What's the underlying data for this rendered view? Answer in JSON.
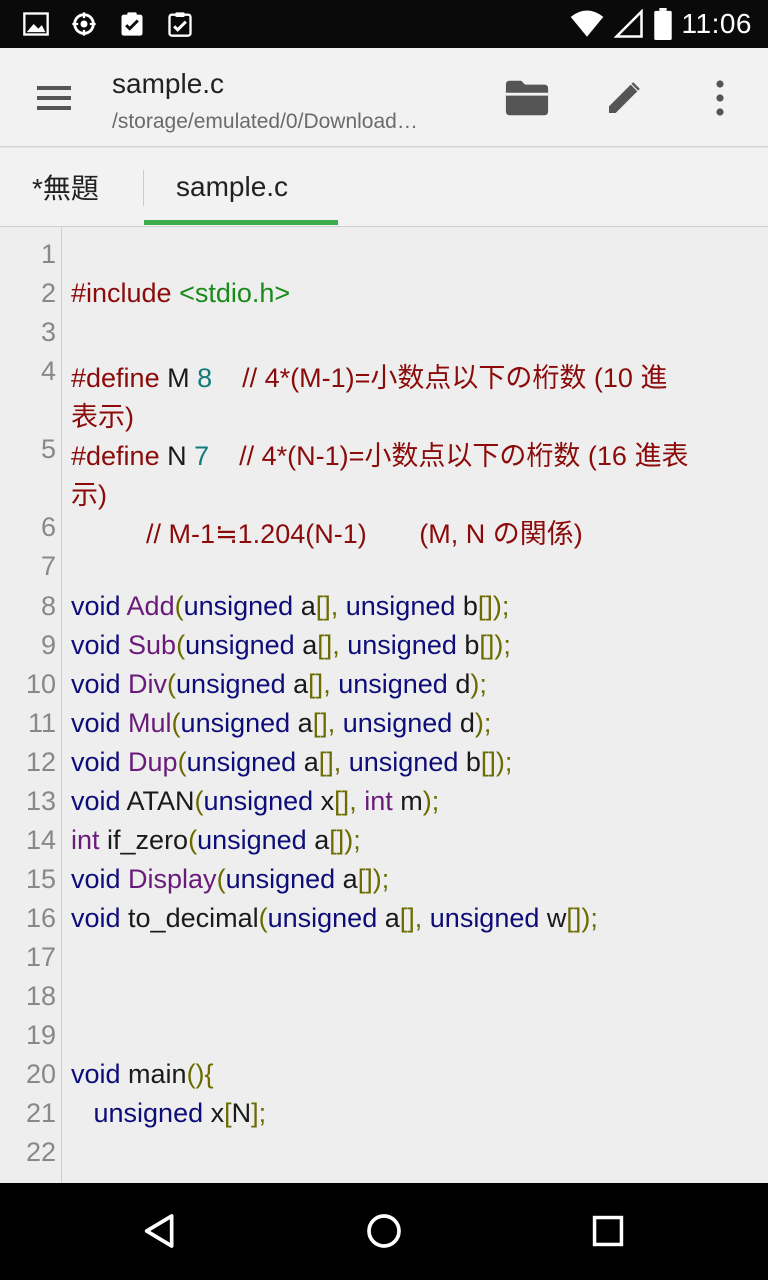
{
  "status_bar": {
    "time": "11:06",
    "left_icons": [
      "image-icon",
      "sync-icon",
      "clipboard-check-icon",
      "clipboard-check-2-icon"
    ],
    "right_icons": [
      "wifi-icon",
      "signal-icon",
      "battery-icon"
    ]
  },
  "app_bar": {
    "title": "sample.c",
    "subtitle": "/storage/emulated/0/Download…"
  },
  "tabs": [
    {
      "label": "*無題",
      "active": false
    },
    {
      "label": "sample.c",
      "active": true
    }
  ],
  "editor": {
    "line_numbers": [
      "1",
      "2",
      "3",
      "4",
      "",
      "5",
      "",
      "6",
      "7",
      "8",
      "9",
      "10",
      "11",
      "12",
      "13",
      "14",
      "15",
      "16",
      "17",
      "18",
      "19",
      "20",
      "21",
      "22"
    ],
    "lines": {
      "l2_a": "#include ",
      "l2_b": "<stdio.h>",
      "l4_a": "#define ",
      "l4_b": "M ",
      "l4_c": "8",
      "l4_d": "    // 4*(M-1)=小数点以下の桁数 (10 進",
      "l4w": "表示)",
      "l5_a": "#define ",
      "l5_b": "N ",
      "l5_c": "7",
      "l5_d": "    // 4*(N-1)=小数点以下の桁数 (16 進表",
      "l5w": "示)",
      "l6": "          // M-1≒1.204(N-1)       (M, N の関係)",
      "l8": [
        "void",
        " Add",
        "(",
        "unsigned",
        " a",
        "[]",
        ", ",
        "unsigned",
        " b",
        "[]",
        ");"
      ],
      "l9": [
        "void",
        " Sub",
        "(",
        "unsigned",
        " a",
        "[]",
        ", ",
        "unsigned",
        " b",
        "[]",
        ");"
      ],
      "l10": [
        "void",
        " Div",
        "(",
        "unsigned",
        " a",
        "[]",
        ", ",
        "unsigned",
        " d",
        ");"
      ],
      "l11": [
        "void",
        " Mul",
        "(",
        "unsigned",
        " a",
        "[]",
        ", ",
        "unsigned",
        " d",
        ");"
      ],
      "l12": [
        "void",
        " Dup",
        "(",
        "unsigned",
        " a",
        "[]",
        ", ",
        "unsigned",
        " b",
        "[]",
        ");"
      ],
      "l13": [
        "void",
        " ATAN",
        "(",
        "unsigned",
        " x",
        "[]",
        ", ",
        "int",
        " m",
        ");"
      ],
      "l14": [
        "int",
        " if_zero",
        "(",
        "unsigned",
        " a",
        "[]",
        ");"
      ],
      "l15": [
        "void",
        " Display",
        "(",
        "unsigned",
        " a",
        "[]",
        ");"
      ],
      "l16": [
        "void",
        " to_decimal",
        "(",
        "unsigned",
        " a",
        "[]",
        ", ",
        "unsigned",
        " w",
        "[]",
        ");"
      ],
      "l20": [
        "void",
        " main",
        "(){"
      ],
      "l21": [
        "   unsigned",
        " x",
        "[",
        "N",
        "];"
      ]
    }
  }
}
